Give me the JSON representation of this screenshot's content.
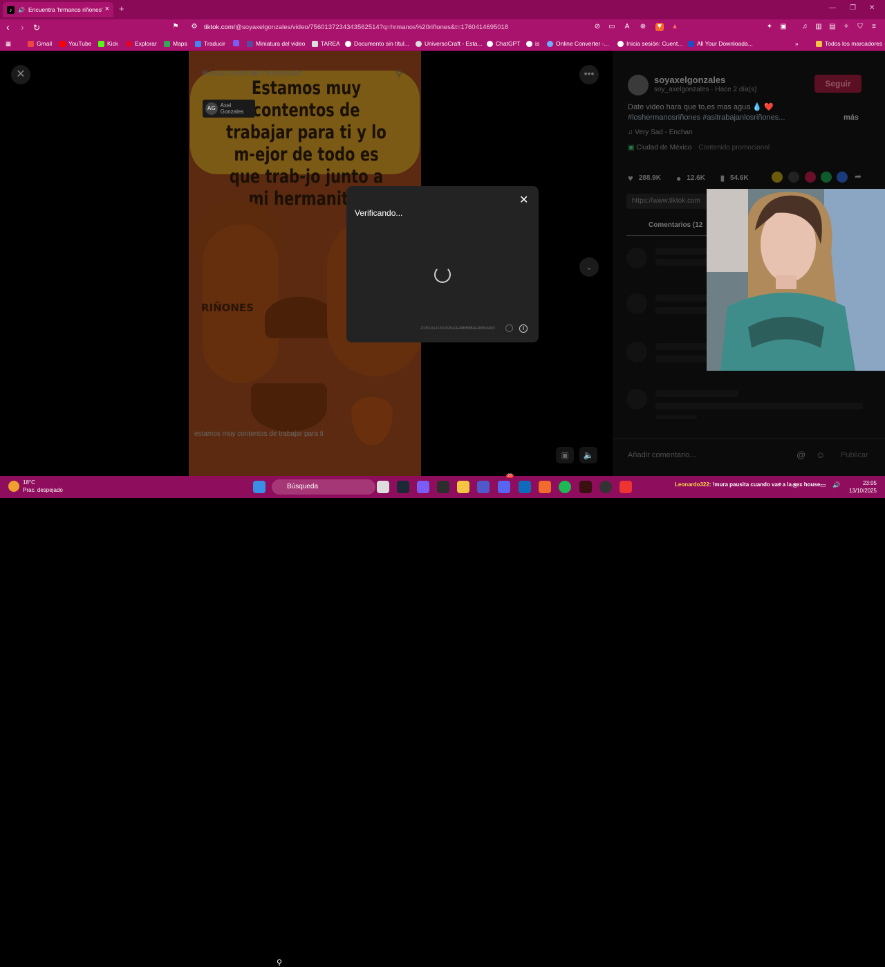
{
  "browser": {
    "tab_title": "Encuentra 'hrmanos riñones'",
    "url_host": "tiktok.com",
    "url_path": "/@soyaxelgonzales/video/7560137234343562514?q=hrmanos%20riñones&t=1760414695018",
    "bookmarks": [
      "Gmail",
      "YouTube",
      "Kick",
      "Explorar",
      "Maps",
      "Traducir",
      "Miniatura del video",
      "TAREA",
      "Documento sin títul...",
      "UniversoCraft - Esta...",
      "ChatGPT",
      "is",
      "Online Converter -...",
      "Inicia sesión: Cuent...",
      "All Your Downloada..."
    ],
    "all_bookmarks": "Todos los marcadores"
  },
  "video": {
    "search_placeholder": "Buscar contenido relacionado",
    "channel_badge": "Axel Gonzales",
    "channel_initials": "AG",
    "art_text": "Estamos muy contentos de trabajar para ti y lo m-ejor de todo es que trab-jo junto a mi hermanito.",
    "art_label": "RIÑONES",
    "subtitle": "estamos muy contentos de trabajar para ti"
  },
  "panel": {
    "username": "soyaxelgonzales",
    "meta": "soy_axelgonzales · Hace 2 día(s)",
    "follow": "Seguir",
    "desc": "Date video hara que to,es mas agua 💧 ❤️",
    "tags": "#loshermanosriñones #asitrabajanlosriñones...",
    "more": "más",
    "music": "Very Sad - Enchan",
    "location": "Ciudad de México",
    "promo": "Contenido promocional",
    "likes": "288.9K",
    "comments_count": "12.6K",
    "saves": "54.6K",
    "link": "https://www.tiktok.com",
    "comments_tab": "Comentarios (12",
    "add_comment": "Añadir comentario...",
    "publish": "Publicar"
  },
  "dialog": {
    "title": "Verificando...",
    "code": "20251014139292542E48BB9BAE35B66802"
  },
  "taskbar": {
    "temp": "18°C",
    "weather": "Prac. despejado",
    "search": "Búsqueda",
    "chat_user": "Leonardo322",
    "chat_msg": ": !mura pausita cuando vas a la sex house",
    "time": "23:05",
    "date": "13/10/2025",
    "discord_badge": "20"
  }
}
